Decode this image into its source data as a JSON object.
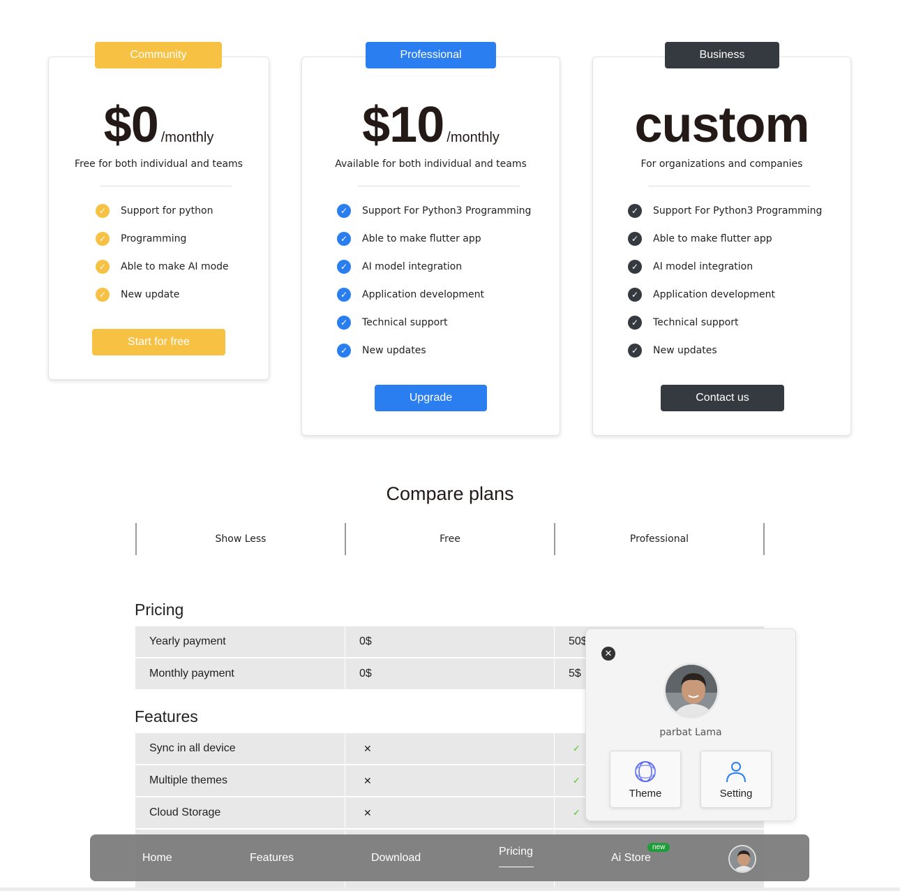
{
  "plans": [
    {
      "badge": "Community",
      "amount": "$0",
      "period": "/monthly",
      "subtitle": "Free for both individual and teams",
      "features": [
        "Support for python",
        "Programming",
        "Able to make AI mode",
        "New update"
      ],
      "cta": "Start for free",
      "color": "#f7c244"
    },
    {
      "badge": "Professional",
      "amount": "$10",
      "period": "/monthly",
      "subtitle": "Available for both individual and teams",
      "features": [
        "Support For Python3 Programming",
        "Able to make flutter app",
        "AI model integration",
        "Application development",
        "Technical support",
        "New updates"
      ],
      "cta": "Upgrade",
      "color": "#2a7ef0"
    },
    {
      "badge": "Business",
      "amount": "custom",
      "subtitle": "For organizations and companies",
      "features": [
        "Support For Python3 Programming",
        "Able to make flutter app",
        "AI model integration",
        "Application development",
        "Technical support",
        "New updates"
      ],
      "cta": "Contact us",
      "color": "#343a40"
    }
  ],
  "compare": {
    "title": "Compare plans",
    "columns": [
      "Show Less",
      "Free",
      "Professional"
    ],
    "pricing_heading": "Pricing",
    "pricing_rows": [
      {
        "label": "Yearly payment",
        "free": "0$",
        "pro": "50$"
      },
      {
        "label": "Monthly payment",
        "free": "0$",
        "pro": "5$"
      }
    ],
    "features_heading": "Features",
    "feature_rows": [
      {
        "label": "Sync in all device",
        "free": "✕",
        "pro": "✓"
      },
      {
        "label": "Multiple themes",
        "free": "✕",
        "pro": "✓"
      },
      {
        "label": "Cloud Storage",
        "free": "✕",
        "pro": "✓"
      }
    ]
  },
  "profile_popup": {
    "name": "parbat Lama",
    "close_icon": "close-icon",
    "tiles": [
      {
        "label": "Theme",
        "icon": "theme-icon"
      },
      {
        "label": "Setting",
        "icon": "user-icon"
      }
    ]
  },
  "nav": {
    "items": [
      "Home",
      "Features",
      "Download",
      "Pricing",
      "Ai Store"
    ],
    "active": "Pricing",
    "badge": "new"
  }
}
